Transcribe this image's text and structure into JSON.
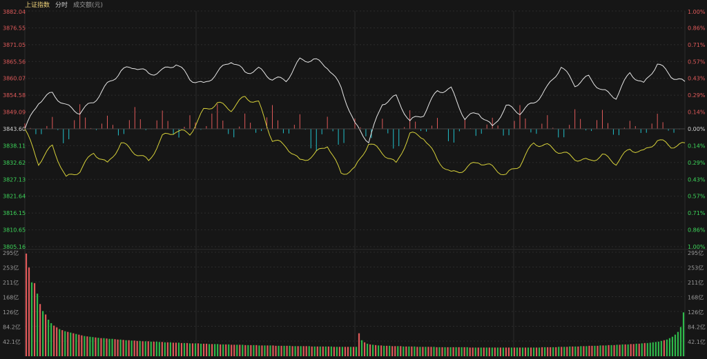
{
  "header": {
    "index_name": "上证指数",
    "period_label": "分时",
    "volume_unit_label": "成交额(元)"
  },
  "colors": {
    "background": "#161616",
    "grid": "#2c2c2c",
    "up": "#e05a5a",
    "down": "#22c1cc",
    "price_line": "#e8e8e8",
    "avg_line": "#d8d23a",
    "label_up": "#e05a5a",
    "label_down": "#3dd65a",
    "label_base": "#d0d0d0",
    "vol_label": "#9a9a9a"
  },
  "chart_data": [
    {
      "type": "line",
      "base_price": 3843.6,
      "ylim": [
        3805.16,
        3882.04
      ],
      "y_ticks_left": [
        "3882.04",
        "3876.55",
        "3871.05",
        "3865.56",
        "3860.07",
        "3854.58",
        "3849.09",
        "3843.60",
        "3838.11",
        "3832.62",
        "3827.13",
        "3821.64",
        "3816.15",
        "3810.65",
        "3805.16"
      ],
      "y_ticks_right": [
        "1.00%",
        "0.86%",
        "0.71%",
        "0.57%",
        "0.43%",
        "0.29%",
        "0.14%",
        "0.00%",
        "0.14%",
        "0.29%",
        "0.43%",
        "0.57%",
        "0.71%",
        "0.86%",
        "1.00%"
      ],
      "x": [
        0,
        5,
        10,
        15,
        20,
        25,
        30,
        35,
        40,
        45,
        50,
        55,
        60,
        65,
        70,
        75,
        80,
        85,
        90,
        95,
        100,
        105,
        110,
        115,
        120,
        125,
        130,
        135,
        140,
        145,
        150,
        155,
        160,
        165,
        170,
        175,
        180,
        185,
        190,
        195,
        200,
        205,
        210,
        215,
        220,
        225,
        230,
        235,
        240
      ],
      "series": [
        {
          "values": [
            3843.6,
            3852.5,
            3855.2,
            3851.0,
            3849.0,
            3852.5,
            3858.0,
            3862.5,
            3864.0,
            3861.5,
            3862.5,
            3865.0,
            3860.0,
            3858.0,
            3862.0,
            3866.0,
            3862.0,
            3863.0,
            3860.0,
            3859.5,
            3866.0,
            3866.2,
            3864.0,
            3857.0,
            3845.0,
            3839.5,
            3852.0,
            3854.0,
            3846.0,
            3848.5,
            3856.0,
            3856.5,
            3847.0,
            3849.0,
            3844.0,
            3851.0,
            3849.0,
            3852.0,
            3857.0,
            3864.0,
            3858.0,
            3860.5,
            3856.0,
            3854.0,
            3862.0,
            3858.0,
            3865.0,
            3861.0,
            3858.5
          ]
        },
        {
          "values": [
            3843.6,
            3832.5,
            3838.0,
            3827.5,
            3830.0,
            3836.0,
            3832.0,
            3839.0,
            3836.0,
            3833.0,
            3841.0,
            3843.0,
            3842.0,
            3849.5,
            3852.0,
            3850.0,
            3854.0,
            3852.0,
            3840.0,
            3838.0,
            3833.0,
            3835.0,
            3838.5,
            3829.0,
            3830.5,
            3839.0,
            3836.0,
            3832.0,
            3842.0,
            3841.0,
            3833.5,
            3829.0,
            3830.5,
            3833.0,
            3831.0,
            3828.5,
            3832.0,
            3839.0,
            3838.0,
            3836.0,
            3834.0,
            3833.0,
            3835.0,
            3832.5,
            3837.0,
            3836.0,
            3840.0,
            3838.0,
            3838.5
          ]
        }
      ]
    },
    {
      "type": "bar",
      "x": [
        0,
        5,
        10,
        15,
        20,
        25,
        30,
        35,
        40,
        45,
        50,
        55,
        60,
        65,
        70,
        75,
        80,
        85,
        90,
        95,
        100,
        105,
        110,
        115,
        120,
        125,
        130,
        135,
        140,
        145,
        150,
        155,
        160,
        165,
        170,
        175,
        180,
        185,
        190,
        195,
        200,
        205,
        210,
        215,
        220,
        225,
        230,
        235,
        240
      ],
      "values": [
        6,
        -7,
        8,
        -14,
        20,
        -4,
        10,
        -8,
        15,
        -5,
        18,
        -10,
        9,
        -3,
        22,
        -12,
        11,
        -6,
        17,
        -9,
        13,
        -21,
        8,
        -16,
        10,
        -11,
        7,
        -18,
        14,
        -6,
        9,
        -13,
        6,
        -8,
        12,
        -10,
        16,
        -7,
        11,
        -14,
        15,
        -5,
        13,
        -9,
        8,
        -6,
        10,
        -4,
        2
      ]
    },
    {
      "type": "bar",
      "ylim": [
        0,
        295
      ],
      "y_ticks": [
        "295亿",
        "253亿",
        "211亿",
        "168亿",
        "126亿",
        "84.2亿",
        "42.1亿"
      ],
      "values": [
        295,
        255,
        212,
        210,
        180,
        150,
        130,
        120,
        105,
        95,
        88,
        83,
        78,
        75,
        72,
        70,
        68,
        66,
        64,
        62,
        60,
        58,
        57,
        56,
        55,
        54,
        53,
        52,
        52,
        51,
        50,
        50,
        49,
        48,
        48,
        47,
        46,
        46,
        45,
        45,
        44,
        44,
        43,
        43,
        43,
        42,
        42,
        42,
        41,
        41,
        40,
        40,
        40,
        39,
        39,
        39,
        38,
        38,
        38,
        37,
        37,
        37,
        37,
        36,
        36,
        36,
        35,
        35,
        35,
        35,
        34,
        34,
        34,
        34,
        33,
        33,
        33,
        33,
        33,
        32,
        32,
        32,
        32,
        32,
        31,
        31,
        31,
        31,
        31,
        31,
        30,
        30,
        30,
        30,
        30,
        30,
        29,
        29,
        29,
        29,
        29,
        29,
        29,
        28,
        28,
        28,
        28,
        28,
        28,
        28,
        28,
        27,
        27,
        27,
        27,
        27,
        27,
        27,
        27,
        27,
        66,
        46,
        40,
        36,
        34,
        33,
        32,
        31,
        31,
        30,
        30,
        30,
        29,
        29,
        29,
        29,
        28,
        28,
        28,
        28,
        28,
        27,
        27,
        27,
        27,
        27,
        27,
        27,
        26,
        26,
        26,
        26,
        26,
        26,
        26,
        26,
        26,
        26,
        26,
        26,
        25,
        25,
        25,
        25,
        25,
        25,
        25,
        25,
        25,
        25,
        25,
        25,
        25,
        25,
        25,
        25,
        25,
        25,
        25,
        25,
        25,
        25,
        25,
        25,
        25,
        25,
        26,
        26,
        26,
        26,
        26,
        26,
        27,
        27,
        27,
        27,
        28,
        28,
        28,
        28,
        29,
        29,
        29,
        30,
        30,
        30,
        30,
        31,
        31,
        31,
        32,
        32,
        32,
        33,
        33,
        34,
        34,
        34,
        35,
        35,
        36,
        36,
        37,
        38,
        38,
        39,
        40,
        41,
        42,
        44,
        46,
        48,
        52,
        56,
        62,
        70,
        84,
        126
      ],
      "directions": [
        "u",
        "u",
        "d",
        "u",
        "d",
        "u",
        "d",
        "u",
        "d",
        "d",
        "u",
        "u",
        "d",
        "u",
        "d",
        "u",
        "d",
        "u",
        "d",
        "u",
        "u",
        "d",
        "u",
        "d",
        "d",
        "u",
        "d",
        "u",
        "d",
        "u",
        "d",
        "d",
        "u",
        "u",
        "d",
        "u",
        "d",
        "u",
        "d",
        "u",
        "u",
        "d",
        "u",
        "d",
        "u",
        "d",
        "u",
        "d",
        "d",
        "u",
        "d",
        "u",
        "d",
        "u",
        "u",
        "d",
        "u",
        "d",
        "u",
        "d",
        "u",
        "d",
        "u",
        "d",
        "u",
        "u",
        "d",
        "u",
        "d",
        "d",
        "u",
        "d",
        "u",
        "d",
        "u",
        "u",
        "d",
        "u",
        "d",
        "u",
        "d",
        "u",
        "d",
        "u",
        "d",
        "u",
        "d",
        "u",
        "d",
        "u",
        "u",
        "d",
        "u",
        "d",
        "u",
        "d",
        "u",
        "d",
        "u",
        "d",
        "u",
        "u",
        "d",
        "u",
        "d",
        "u",
        "d",
        "u",
        "d",
        "u",
        "d",
        "u",
        "d",
        "u",
        "d",
        "u",
        "u",
        "d",
        "u",
        "d",
        "u",
        "d",
        "u",
        "d",
        "u",
        "d",
        "u",
        "d",
        "u",
        "d",
        "u",
        "d",
        "u",
        "u",
        "d",
        "u",
        "d",
        "u",
        "d",
        "u",
        "d",
        "u",
        "d",
        "u",
        "d",
        "u",
        "u",
        "d",
        "u",
        "d",
        "u",
        "d",
        "u",
        "d",
        "u",
        "d",
        "u",
        "d",
        "u",
        "d",
        "u",
        "u",
        "d",
        "u",
        "d",
        "u",
        "d",
        "u",
        "d",
        "u",
        "d",
        "u",
        "d",
        "u",
        "u",
        "d",
        "u",
        "d",
        "u",
        "d",
        "u",
        "d",
        "u",
        "d",
        "u",
        "d",
        "u",
        "d",
        "u",
        "u",
        "d",
        "u",
        "d",
        "u",
        "d",
        "u",
        "d",
        "u",
        "d",
        "u",
        "d",
        "u",
        "d",
        "u",
        "u",
        "d",
        "u",
        "d",
        "u",
        "d",
        "u",
        "d",
        "u",
        "d",
        "u",
        "d",
        "u",
        "d",
        "u",
        "u",
        "d",
        "u",
        "d",
        "u",
        "d",
        "d",
        "d",
        "d",
        "d",
        "d",
        "u",
        "d"
      ]
    }
  ]
}
